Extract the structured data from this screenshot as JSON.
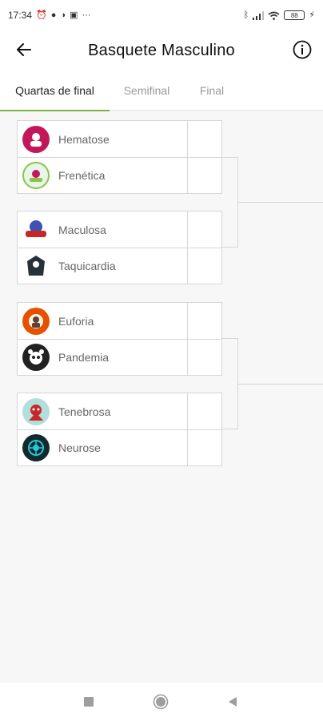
{
  "status_bar": {
    "time": "17:34",
    "more": "···",
    "battery": "88"
  },
  "header": {
    "title": "Basquete Masculino"
  },
  "tabs": [
    {
      "label": "Quartas de final",
      "active": true
    },
    {
      "label": "Semifinal",
      "active": false
    },
    {
      "label": "Final",
      "active": false
    }
  ],
  "matches": [
    {
      "teams": [
        {
          "name": "Hematose",
          "score": ""
        },
        {
          "name": "Frenética",
          "score": ""
        }
      ]
    },
    {
      "teams": [
        {
          "name": "Maculosa",
          "score": ""
        },
        {
          "name": "Taquicardia",
          "score": ""
        }
      ]
    },
    {
      "teams": [
        {
          "name": "Euforia",
          "score": ""
        },
        {
          "name": "Pandemia",
          "score": ""
        }
      ]
    },
    {
      "teams": [
        {
          "name": "Tenebrosa",
          "score": ""
        },
        {
          "name": "Neurose",
          "score": ""
        }
      ]
    }
  ],
  "colors": {
    "accent": "#7cb342",
    "border": "#d6d6d6",
    "logos": [
      "#c2185b",
      "#8bc34a",
      "#3f51b5",
      "#263238",
      "#e65100",
      "#212121",
      "#00897b",
      "#00838f"
    ]
  }
}
